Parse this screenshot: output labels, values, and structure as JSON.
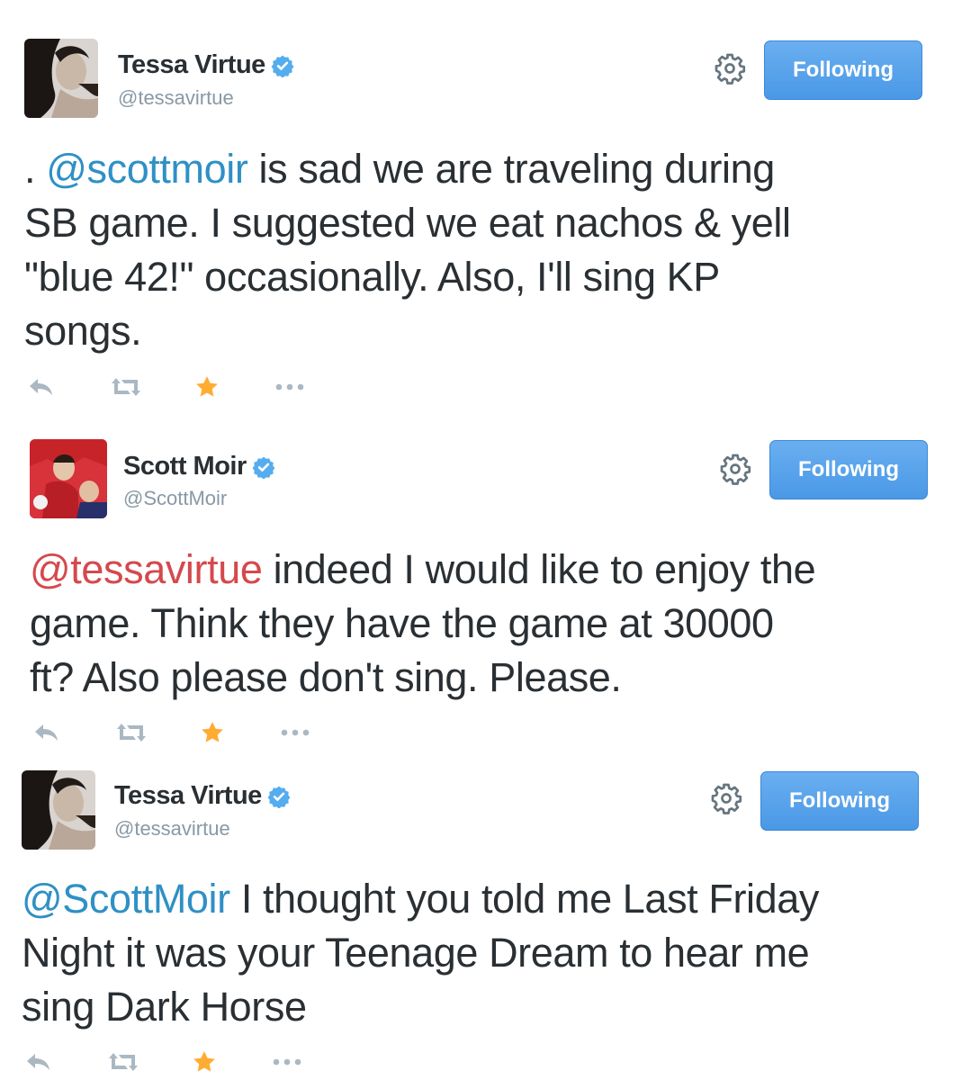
{
  "tweets": [
    {
      "name": "Tessa Virtue",
      "handle": "@tessavirtue",
      "follow_label": "Following",
      "verified": true,
      "text_lines": [
        [
          {
            "t": ". ",
            "k": "plain"
          },
          {
            "t": "@scottmoir",
            "k": "mention"
          },
          {
            "t": " is sad we are traveling during",
            "k": "plain"
          }
        ],
        [
          {
            "t": "SB game. I suggested we eat nachos & yell",
            "k": "plain"
          }
        ],
        [
          {
            "t": "\"blue 42!\" occasionally. Also, I'll sing KP",
            "k": "plain"
          }
        ],
        [
          {
            "t": "songs.",
            "k": "plain"
          }
        ]
      ],
      "favorited": true
    },
    {
      "name": "Scott Moir",
      "handle": "@ScottMoir",
      "follow_label": "Following",
      "verified": true,
      "text_lines": [
        [
          {
            "t": "@tessavirtue",
            "k": "mention-red"
          },
          {
            "t": " indeed I would like to enjoy the",
            "k": "plain"
          }
        ],
        [
          {
            "t": "game. Think they have the game at 30000",
            "k": "plain"
          }
        ],
        [
          {
            "t": "ft? Also please don't sing. Please.",
            "k": "plain"
          }
        ]
      ],
      "favorited": true
    },
    {
      "name": "Tessa Virtue",
      "handle": "@tessavirtue",
      "follow_label": "Following",
      "verified": true,
      "text_lines": [
        [
          {
            "t": "@ScottMoir",
            "k": "mention"
          },
          {
            "t": " I thought you told me Last Friday",
            "k": "plain"
          }
        ],
        [
          {
            "t": "Night it was your Teenage Dream to hear me",
            "k": "plain"
          }
        ],
        [
          {
            "t": "sing Dark Horse",
            "k": "plain"
          }
        ]
      ],
      "favorited": true
    }
  ],
  "icons": {
    "reply": "reply-icon",
    "retweet": "retweet-icon",
    "favorite": "star-icon",
    "more": "more-icon",
    "settings": "gear-icon",
    "verified": "verified-badge-icon"
  },
  "colors": {
    "mention_blue": "#2f90c5",
    "mention_red": "#d4494d",
    "follow_button": "#55a3ec",
    "favorite_star": "#ffac33",
    "muted": "#8899a6"
  }
}
